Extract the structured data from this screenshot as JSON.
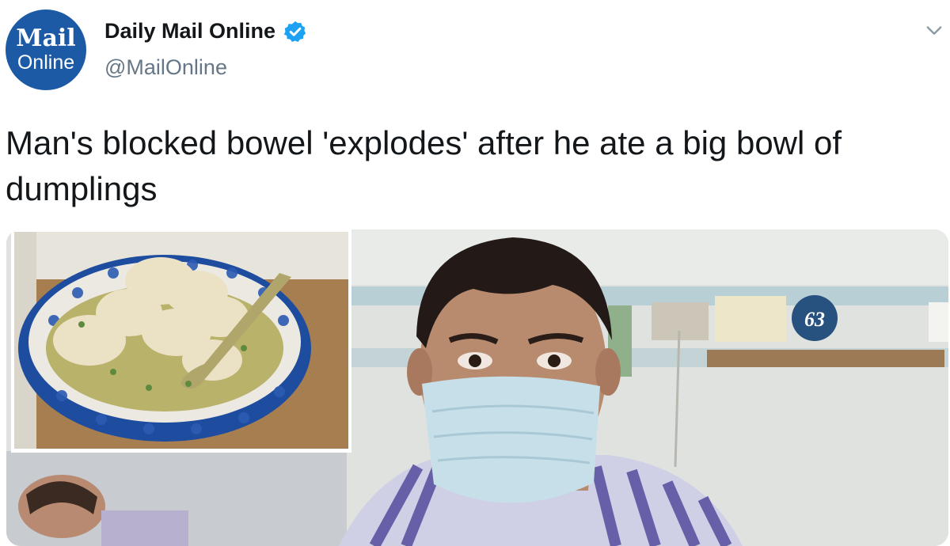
{
  "account": {
    "avatar_text_line1": "Mail",
    "avatar_text_line2": "Online",
    "display_name": "Daily Mail Online",
    "handle": "@MailOnline",
    "verified": true
  },
  "icons": {
    "verified": "verified-badge-icon",
    "more": "chevron-down-icon"
  },
  "tweet": {
    "text": "Man's blocked bowel 'explodes' after he ate a big bowl of dumplings"
  },
  "media": {
    "bed_number": "63",
    "description_inset": "bowl of dumplings",
    "description_main": "man in surgical mask in hospital bed"
  },
  "colors": {
    "brand_blue": "#1d5aa6",
    "verified_blue": "#1da1f2",
    "text": "#14171a",
    "muted": "#657786"
  }
}
